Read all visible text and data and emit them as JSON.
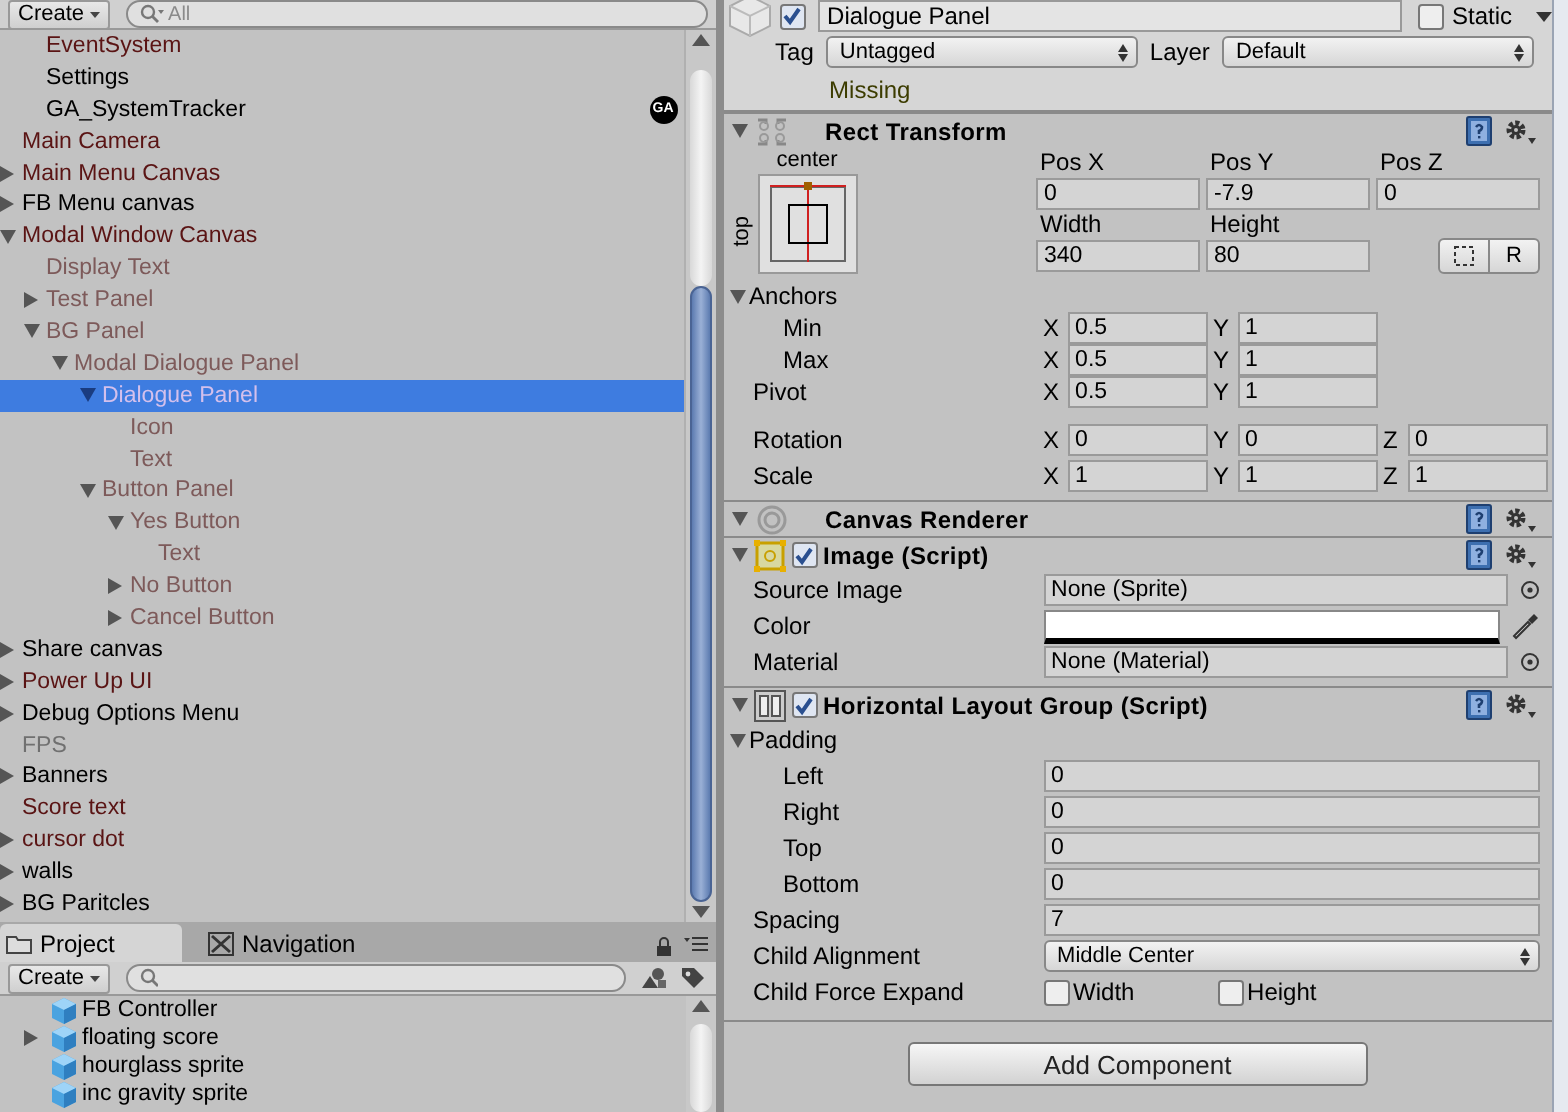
{
  "hierarchy": {
    "toolbar": {
      "create": "Create",
      "search_placeholder": "All"
    },
    "clipped_items": [
      {
        "label": "EventSystem",
        "color": "#5a1414",
        "selected": false
      },
      {
        "label": "Settings",
        "color": "#000000",
        "selected": false
      },
      {
        "label": "GA_SystemTracker",
        "color": "#000000",
        "selected": false,
        "badge": "GA"
      }
    ],
    "items": [
      {
        "label": "Main Camera",
        "color": "#5a1414",
        "selected": false
      },
      {
        "label": "Main Menu Canvas",
        "color": "#5a1414",
        "selected": false,
        "expanded": false
      },
      {
        "label": "FB Menu canvas",
        "color": "#000000",
        "selected": false,
        "expanded": false
      },
      {
        "label": "Modal Window Canvas",
        "color": "#5a1414",
        "selected": false,
        "expanded": true,
        "children": [
          {
            "label": "Display Text",
            "color": "#7d5a5a",
            "selected": false
          },
          {
            "label": "Test Panel",
            "color": "#7d5a5a",
            "selected": false,
            "expanded": false
          },
          {
            "label": "BG Panel",
            "color": "#7d5a5a",
            "selected": false,
            "expanded": true,
            "children": [
              {
                "label": "Modal Dialogue Panel",
                "color": "#7d5a5a",
                "selected": false,
                "expanded": true,
                "children": [
                  {
                    "label": "Dialogue Panel",
                    "color": "#d4c0ec",
                    "selected": true,
                    "expanded": true,
                    "children": [
                      {
                        "label": "Icon",
                        "color": "#7d5a5a",
                        "selected": false
                      },
                      {
                        "label": "Text",
                        "color": "#7d5a5a",
                        "selected": false
                      }
                    ]
                  },
                  {
                    "label": "Button Panel",
                    "color": "#7d5a5a",
                    "selected": false,
                    "expanded": true,
                    "children": [
                      {
                        "label": "Yes Button",
                        "color": "#7d5a5a",
                        "selected": false,
                        "expanded": true,
                        "children": [
                          {
                            "label": "Text",
                            "color": "#7d5a5a",
                            "selected": false
                          }
                        ]
                      },
                      {
                        "label": "No Button",
                        "color": "#7d5a5a",
                        "selected": false,
                        "expanded": false
                      },
                      {
                        "label": "Cancel Button",
                        "color": "#7d5a5a",
                        "selected": false,
                        "expanded": false
                      }
                    ]
                  }
                ]
              }
            ]
          }
        ]
      },
      {
        "label": "Share canvas",
        "color": "#000000",
        "selected": false,
        "expanded": false
      },
      {
        "label": "Power Up UI",
        "color": "#5a1414",
        "selected": false,
        "expanded": false
      },
      {
        "label": "Debug Options Menu",
        "color": "#000000",
        "selected": false,
        "expanded": false
      },
      {
        "label": "FPS",
        "color": "#707070",
        "selected": false
      },
      {
        "label": "Banners",
        "color": "#000000",
        "selected": false,
        "expanded": false
      },
      {
        "label": "Score text",
        "color": "#5a1414",
        "selected": false
      },
      {
        "label": "cursor dot",
        "color": "#5a1414",
        "selected": false,
        "expanded": false
      },
      {
        "label": "walls",
        "color": "#000000",
        "selected": false,
        "expanded": false
      },
      {
        "label": "BG Paritcles",
        "color": "#000000",
        "selected": false,
        "expanded": false
      }
    ]
  },
  "project": {
    "tabs": [
      {
        "label": "Project",
        "selected": true
      },
      {
        "label": "Navigation",
        "selected": false
      }
    ],
    "toolbar": {
      "create": "Create"
    },
    "items": [
      {
        "label": "FB Controller",
        "selected": false
      },
      {
        "label": "floating score",
        "selected": false,
        "expanded": false
      },
      {
        "label": "hourglass sprite",
        "selected": false
      },
      {
        "label": "inc gravity sprite",
        "selected": false
      }
    ]
  },
  "inspector": {
    "header": {
      "active": true,
      "name": "Dialogue Panel",
      "static": false,
      "static_label": "Static",
      "tag_label": "Tag",
      "tag": "Untagged",
      "layer_label": "Layer",
      "layer": "Default",
      "missing": "Missing"
    },
    "components": [
      {
        "kind": "rect_transform",
        "title": "Rect Transform",
        "preset": {
          "h_label": "center",
          "v_label": "top"
        },
        "position_fields": [
          {
            "label": "Pos X",
            "value": "0"
          },
          {
            "label": "Pos Y",
            "value": "-7.9"
          },
          {
            "label": "Pos Z",
            "value": "0"
          }
        ],
        "size_fields": [
          {
            "label": "Width",
            "value": "340"
          },
          {
            "label": "Height",
            "value": "80"
          }
        ],
        "raw_button": "R",
        "properties": [
          {
            "kind": "foldout",
            "label": "Anchors",
            "expanded": true,
            "children": [
              {
                "kind": "vector",
                "label": "Min",
                "axes": [
                  {
                    "axis": "X",
                    "value": "0.5"
                  },
                  {
                    "axis": "Y",
                    "value": "1"
                  }
                ]
              },
              {
                "kind": "vector",
                "label": "Max",
                "axes": [
                  {
                    "axis": "X",
                    "value": "0.5"
                  },
                  {
                    "axis": "Y",
                    "value": "1"
                  }
                ]
              }
            ]
          },
          {
            "kind": "vector",
            "label": "Pivot",
            "axes": [
              {
                "axis": "X",
                "value": "0.5"
              },
              {
                "axis": "Y",
                "value": "1"
              }
            ]
          }
        ],
        "transform_properties": [
          {
            "kind": "vector",
            "label": "Rotation",
            "axes": [
              {
                "axis": "X",
                "value": "0"
              },
              {
                "axis": "Y",
                "value": "0"
              },
              {
                "axis": "Z",
                "value": "0"
              }
            ]
          },
          {
            "kind": "vector",
            "label": "Scale",
            "axes": [
              {
                "axis": "X",
                "value": "1"
              },
              {
                "axis": "Y",
                "value": "1"
              },
              {
                "axis": "Z",
                "value": "1"
              }
            ]
          }
        ]
      },
      {
        "kind": "canvas_renderer",
        "title": "Canvas Renderer"
      },
      {
        "kind": "image",
        "title": "Image (Script)",
        "enabled": true,
        "properties": [
          {
            "kind": "object",
            "label": "Source Image",
            "value": "None (Sprite)"
          },
          {
            "kind": "color",
            "label": "Color",
            "color": "#ffffff"
          },
          {
            "kind": "object",
            "label": "Material",
            "value": "None (Material)"
          }
        ]
      },
      {
        "kind": "layout_group",
        "title": "Horizontal Layout Group (Script)",
        "enabled": true,
        "properties": [
          {
            "kind": "foldout",
            "label": "Padding",
            "expanded": true,
            "children": [
              {
                "kind": "number",
                "label": "Left",
                "value": "0"
              },
              {
                "kind": "number",
                "label": "Right",
                "value": "0"
              },
              {
                "kind": "number",
                "label": "Top",
                "value": "0"
              },
              {
                "kind": "number",
                "label": "Bottom",
                "value": "0"
              }
            ]
          },
          {
            "kind": "number",
            "label": "Spacing",
            "value": "7"
          },
          {
            "kind": "dropdown",
            "label": "Child Alignment",
            "value": "Middle Center"
          },
          {
            "kind": "toggles",
            "label": "Child Force Expand",
            "options": [
              {
                "label": "Width",
                "checked": false
              },
              {
                "label": "Height",
                "checked": false
              }
            ]
          }
        ]
      }
    ],
    "add_button": "Add Component"
  }
}
